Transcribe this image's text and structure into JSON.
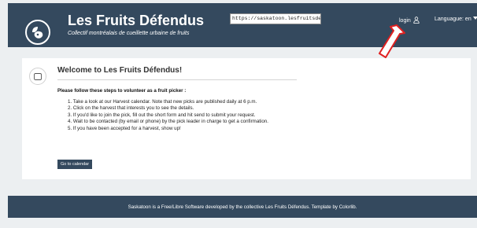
{
  "header": {
    "title": "Les Fruits Défendus",
    "subtitle": "Collectif montréalais de cueillette urbaine de fruits",
    "url": "https://saskatoon.lesfruitsdefendus.org/",
    "login_label": "login",
    "language_label": "Languague: en",
    "icons": {
      "logo": "fruit-logo-icon",
      "login": "user-icon",
      "language": "caret-down-icon"
    }
  },
  "main": {
    "welcome_title": "Welcome to Les Fruits Défendus!",
    "instructions_heading": "Please follow these steps to volunteer as a fruit picker :",
    "steps": [
      "1. Take a look at our Harvest calendar. Note that new picks are published daily at 6 p.m.",
      "2. Click on the harvest that interests you to see the details.",
      "3. If you'd like to join the pick, fill out the short form and hit send to submit your request.",
      "4. Wait to be contacted (by email or phone) by the pick leader in charge to get a confirmation.",
      "5. If you have been accepted for a harvest, show up!"
    ],
    "calendar_button": "Go to calendar"
  },
  "footer": {
    "text": "Saskatoon is a Free/Libre Software developed by the collective Les Fruits Défendus. Template by Colorlib."
  },
  "colors": {
    "header_bg": "#34495e",
    "page_bg": "#eceff1",
    "card_bg": "#ffffff",
    "annotation_arrow": "#e02020"
  }
}
